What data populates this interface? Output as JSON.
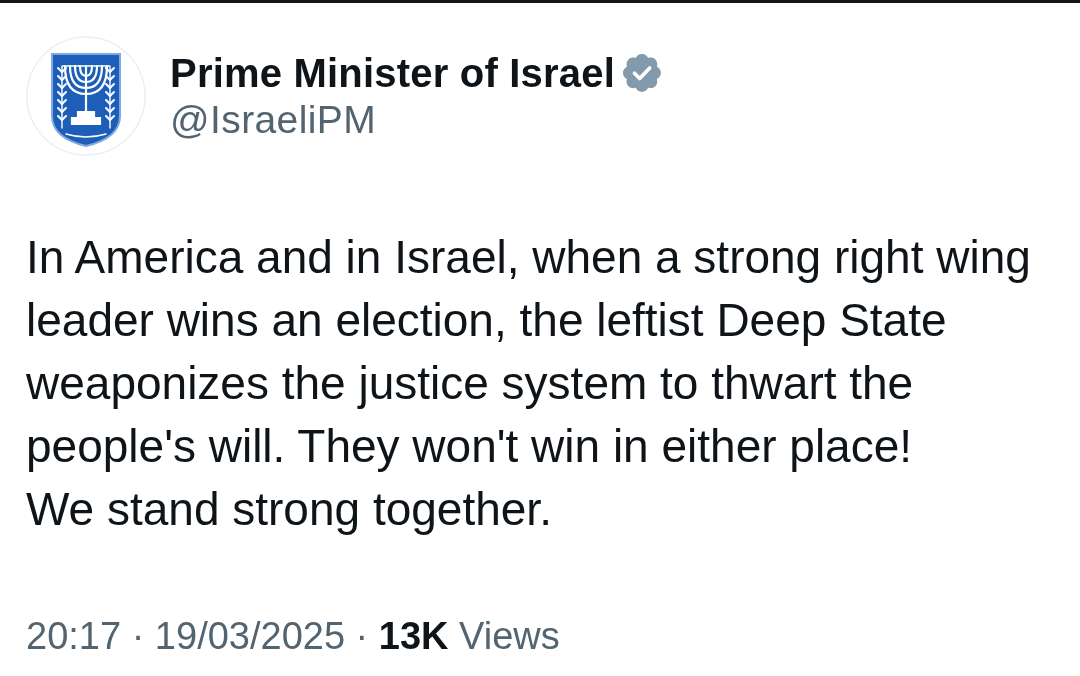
{
  "post": {
    "author": {
      "name": "Prime Minister of Israel",
      "verified": true,
      "handle": "@IsraeliPM"
    },
    "body": [
      "In America and in Israel, when a strong right wing leader wins an election, the leftist Deep State weaponizes the justice system to thwart the people's will. They won't win in either place!",
      "We stand strong together."
    ],
    "meta": "20:17 · 19/03/2025 · **13K** Views"
  }
}
